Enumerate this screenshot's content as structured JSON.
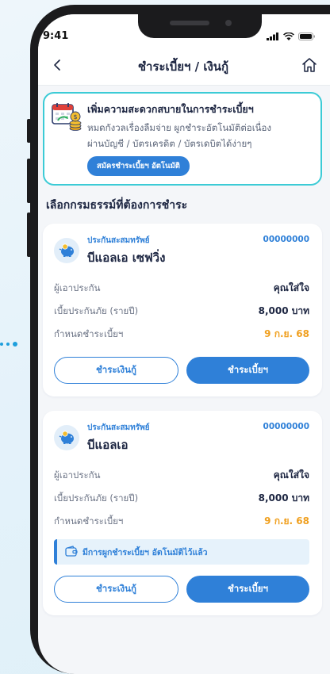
{
  "status_bar": {
    "time": "9:41"
  },
  "header": {
    "title": "ชำระเบี้ยฯ / เงินกู้"
  },
  "promo": {
    "title": "เพิ่มความสะดวกสบายในการชำระเบี้ยฯ",
    "desc_line1": "หมดกังวลเรื่องลืมจ่าย ผูกชำระอัตโนมัติต่อเนื่อง",
    "desc_line2": "ผ่านบัญชี / บัตรเครดิต / บัตรเดบิตได้ง่ายๆ",
    "button_label": "สมัครชำระเบี้ยฯ อัตโนมัติ"
  },
  "section_title": "เลือกกรมธรรม์ที่ต้องการชำระ",
  "policies": [
    {
      "category": "ประกันสะสมทรัพย์",
      "name": "บีแอลเอ เซฟวิ่ง",
      "policy_no": "00000000",
      "rows": [
        {
          "label": "ผู้เอาประกัน",
          "value": "คุณใส่ใจ"
        },
        {
          "label": "เบี้ยประกันภัย (รายปี)",
          "value": "8,000 บาท"
        },
        {
          "label": "กำหนดชำระเบี้ยฯ",
          "value": "9 ก.ย. 68"
        }
      ],
      "notice": "",
      "loan_button": "ชำระเงินกู้",
      "premium_button": "ชำระเบี้ยฯ"
    },
    {
      "category": "ประกันสะสมทรัพย์",
      "name": "บีแอลเอ",
      "policy_no": "00000000",
      "rows": [
        {
          "label": "ผู้เอาประกัน",
          "value": "คุณใส่ใจ"
        },
        {
          "label": "เบี้ยประกันภัย (รายปี)",
          "value": "8,000 บาท"
        },
        {
          "label": "กำหนดชำระเบี้ยฯ",
          "value": "9 ก.ย. 68"
        }
      ],
      "notice": "มีการผูกชำระเบี้ยฯ อัตโนมัติไว้แล้ว",
      "loan_button": "ชำระเงินกู้",
      "premium_button": "ชำระเบี้ยฯ"
    }
  ],
  "colors": {
    "accent": "#2f80d8",
    "promo_border": "#3ccbd6",
    "due_date": "#f0a020",
    "title_text": "#1c2541"
  },
  "icons": {
    "back": "chevron-left-icon",
    "home": "home-icon",
    "promo": "calendar-coins-icon",
    "policy": "piggy-bank-icon",
    "notice": "wallet-icon"
  }
}
